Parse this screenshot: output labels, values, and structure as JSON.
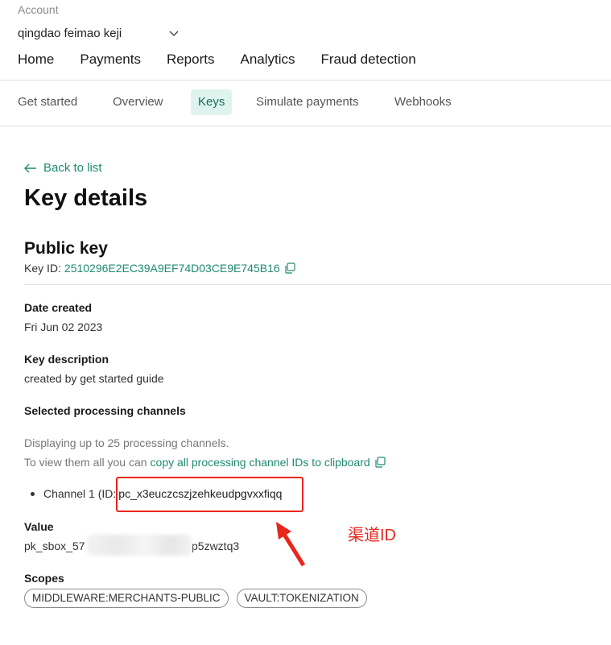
{
  "header": {
    "account_label": "Account",
    "account_name": "qingdao feimao keji",
    "nav": [
      {
        "label": "Home"
      },
      {
        "label": "Payments"
      },
      {
        "label": "Reports"
      },
      {
        "label": "Analytics"
      },
      {
        "label": "Fraud detection"
      }
    ]
  },
  "subnav": {
    "tabs": [
      {
        "label": "Get started"
      },
      {
        "label": "Overview"
      },
      {
        "label": "Keys",
        "active": true
      },
      {
        "label": "Simulate payments"
      },
      {
        "label": "Webhooks"
      }
    ]
  },
  "content": {
    "back_label": "Back to list",
    "page_title": "Key details",
    "key_type": "Public key",
    "key_id_label": "Key ID:",
    "key_id_value": "2510296E2EC39A9EF74D03CE9E745B16",
    "date_created_label": "Date created",
    "date_created_value": "Fri Jun 02 2023",
    "key_description_label": "Key description",
    "key_description_value": "created by get started guide",
    "channels_label": "Selected processing channels",
    "channels_note": "Displaying up to 25 processing channels.",
    "channels_view_prefix": "To view them all you can",
    "channels_copy_link": "copy all processing channel IDs to clipboard",
    "channel_prefix": "Channel 1 (ID:",
    "channel_id": "pc_x3euczcszjzehkeudpgvxxfiqq",
    "value_label": "Value",
    "value_prefix": "pk_sbox_57",
    "value_suffix": "p5zwztq3",
    "scopes_label": "Scopes",
    "scopes": [
      "MIDDLEWARE:MERCHANTS-PUBLIC",
      "VAULT:TOKENIZATION"
    ]
  },
  "annotation": {
    "text": "渠道ID",
    "color": "#e8261c"
  },
  "colors": {
    "accent": "#1f8a70",
    "active_tab_bg": "#dff3ee"
  }
}
